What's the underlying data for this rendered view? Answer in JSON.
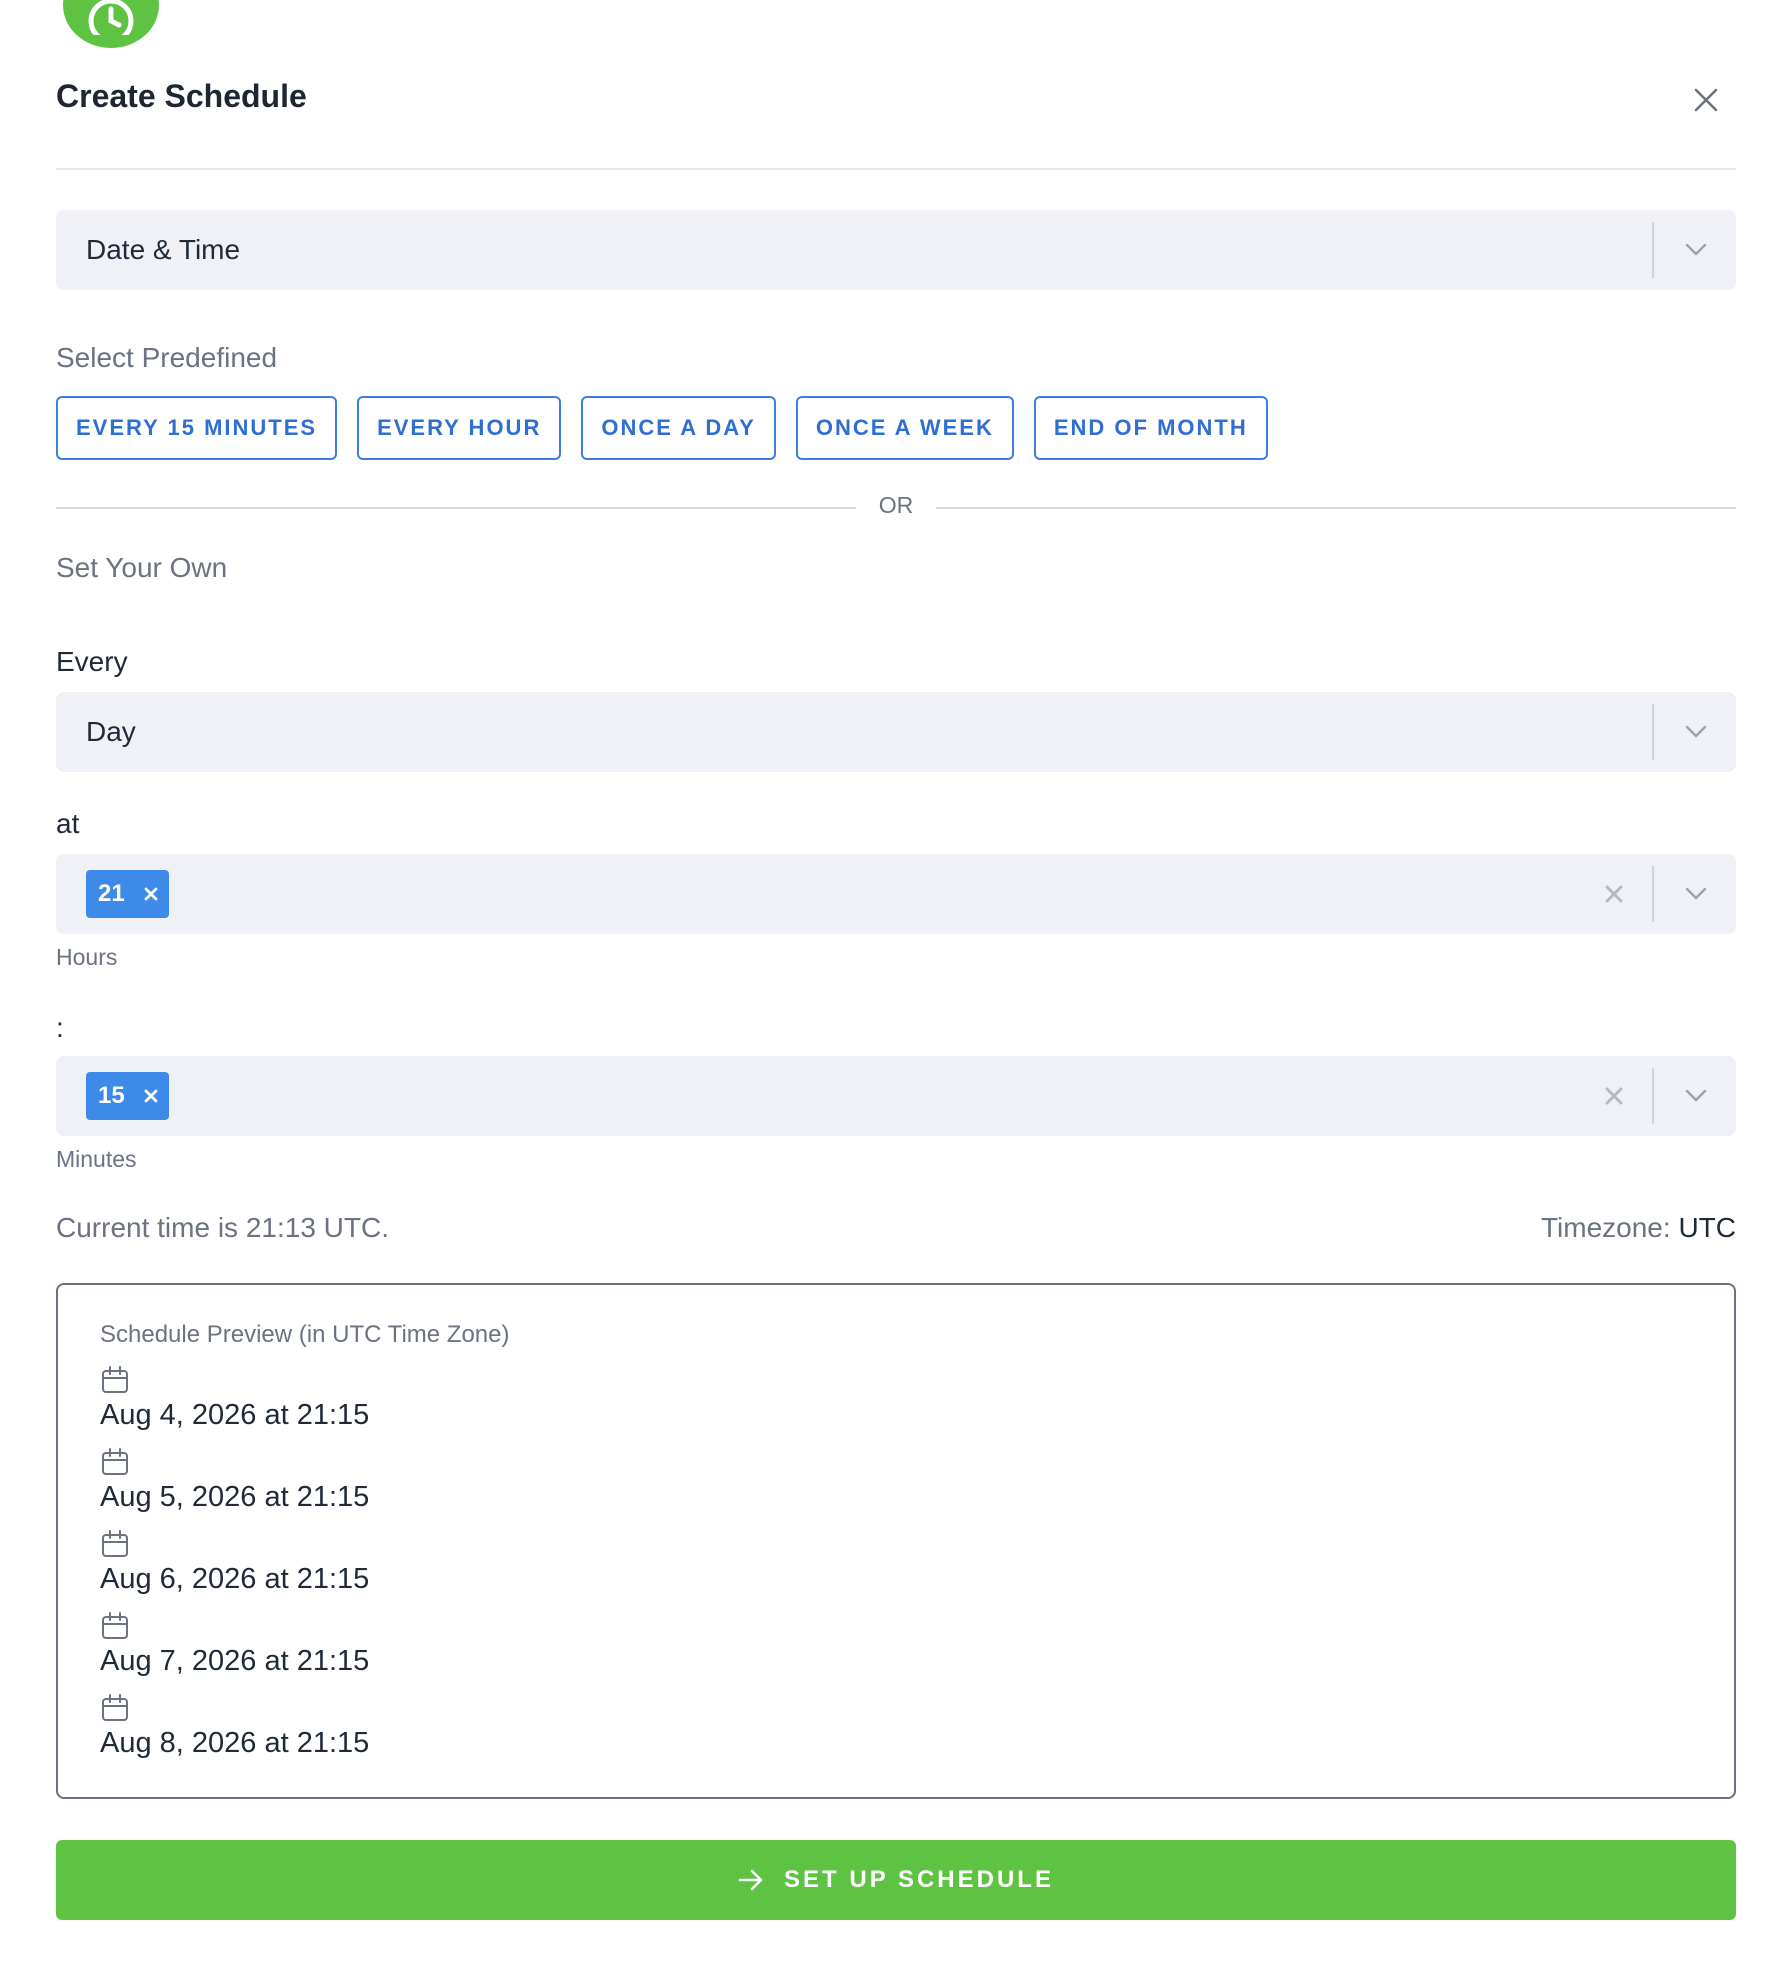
{
  "colors": {
    "brand_green": "#5ec343",
    "preset_blue": "#2f6fd1",
    "chip_blue": "#3d8ae8",
    "field_bg": "#eff1f6"
  },
  "header": {
    "title": "Create Schedule"
  },
  "schedule_type": {
    "value": "Date & Time"
  },
  "predefined": {
    "label": "Select Predefined",
    "options": [
      "EVERY 15 MINUTES",
      "EVERY HOUR",
      "ONCE A DAY",
      "ONCE A WEEK",
      "END OF MONTH"
    ]
  },
  "divider": {
    "text": "OR"
  },
  "custom": {
    "label": "Set Your Own",
    "every_label": "Every",
    "every_value": "Day",
    "at_label": "at",
    "hours_value": "21",
    "hours_hint": "Hours",
    "colon_label": ":",
    "minutes_value": "15",
    "minutes_hint": "Minutes"
  },
  "status": {
    "current_time": "Current time is 21:13 UTC.",
    "timezone_label": "Timezone:",
    "timezone_value": "UTC"
  },
  "preview": {
    "title": "Schedule Preview (in UTC Time Zone)",
    "items": [
      "Aug 4, 2026 at 21:15",
      "Aug 5, 2026 at 21:15",
      "Aug 6, 2026 at 21:15",
      "Aug 7, 2026 at 21:15",
      "Aug 8, 2026 at 21:15"
    ]
  },
  "submit": {
    "label": "SET UP SCHEDULE"
  }
}
